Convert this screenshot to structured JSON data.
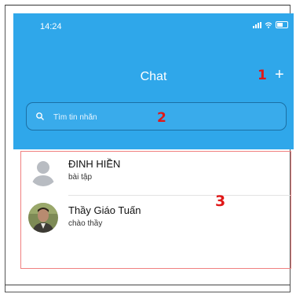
{
  "status_bar": {
    "time": "14:24",
    "icons": [
      "signal-icon",
      "wifi-icon",
      "battery-icon"
    ]
  },
  "header": {
    "title": "Chat",
    "add_icon": "+",
    "color": "#2fa7ea"
  },
  "search": {
    "placeholder": "Tìm tin nhắn",
    "icon": "search-icon"
  },
  "annotations": {
    "one": "1",
    "two": "2",
    "three": "3",
    "color": "#e01818"
  },
  "conversations": [
    {
      "name": "ĐINH HIỀN",
      "preview": "bài tập",
      "avatar": "default-avatar-icon"
    },
    {
      "name": "Thầy Giáo Tuấn",
      "preview": "chào thầy",
      "avatar": "photo-avatar"
    }
  ]
}
